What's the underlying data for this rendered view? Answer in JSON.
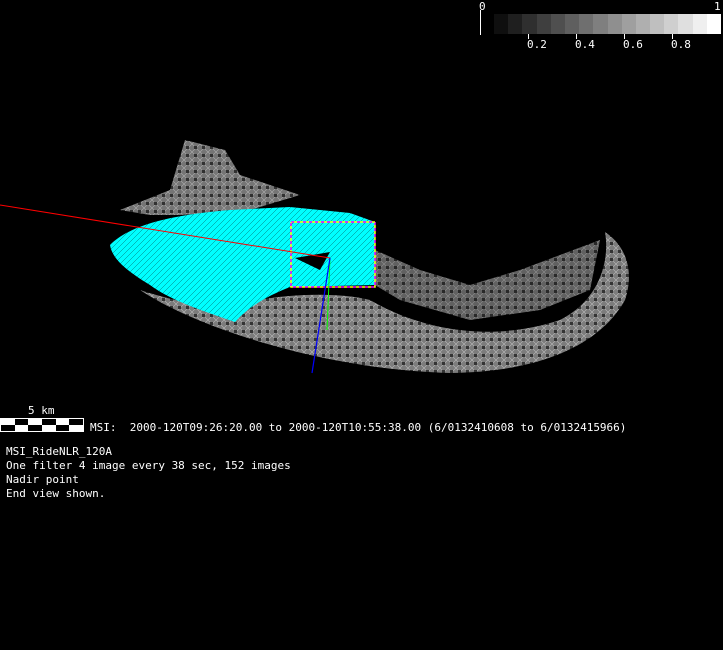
{
  "colorbar": {
    "min_label": "0",
    "max_label": "1",
    "ticks": [
      "0.2",
      "0.4",
      "0.6",
      "0.8"
    ],
    "steps": 16
  },
  "scale_bar": {
    "label": "5 km"
  },
  "info": {
    "time_range": "MSI:  2000-120T09:26:20.00 to 2000-120T10:55:38.00 (6/0132410608 to 6/0132415966)",
    "sequence_name": "MSI_RideNLR_120A",
    "description": "One filter 4 image every 38 sec, 152 images",
    "pointing": "Nadir point",
    "view_note": "End view shown."
  },
  "colors": {
    "footprint": "#00ffff",
    "sun_vector": "#ff0000",
    "boresight": "#0000ff",
    "frame_a": "#ff00ff",
    "frame_b": "#ffff00",
    "normal": "#00ff00"
  }
}
